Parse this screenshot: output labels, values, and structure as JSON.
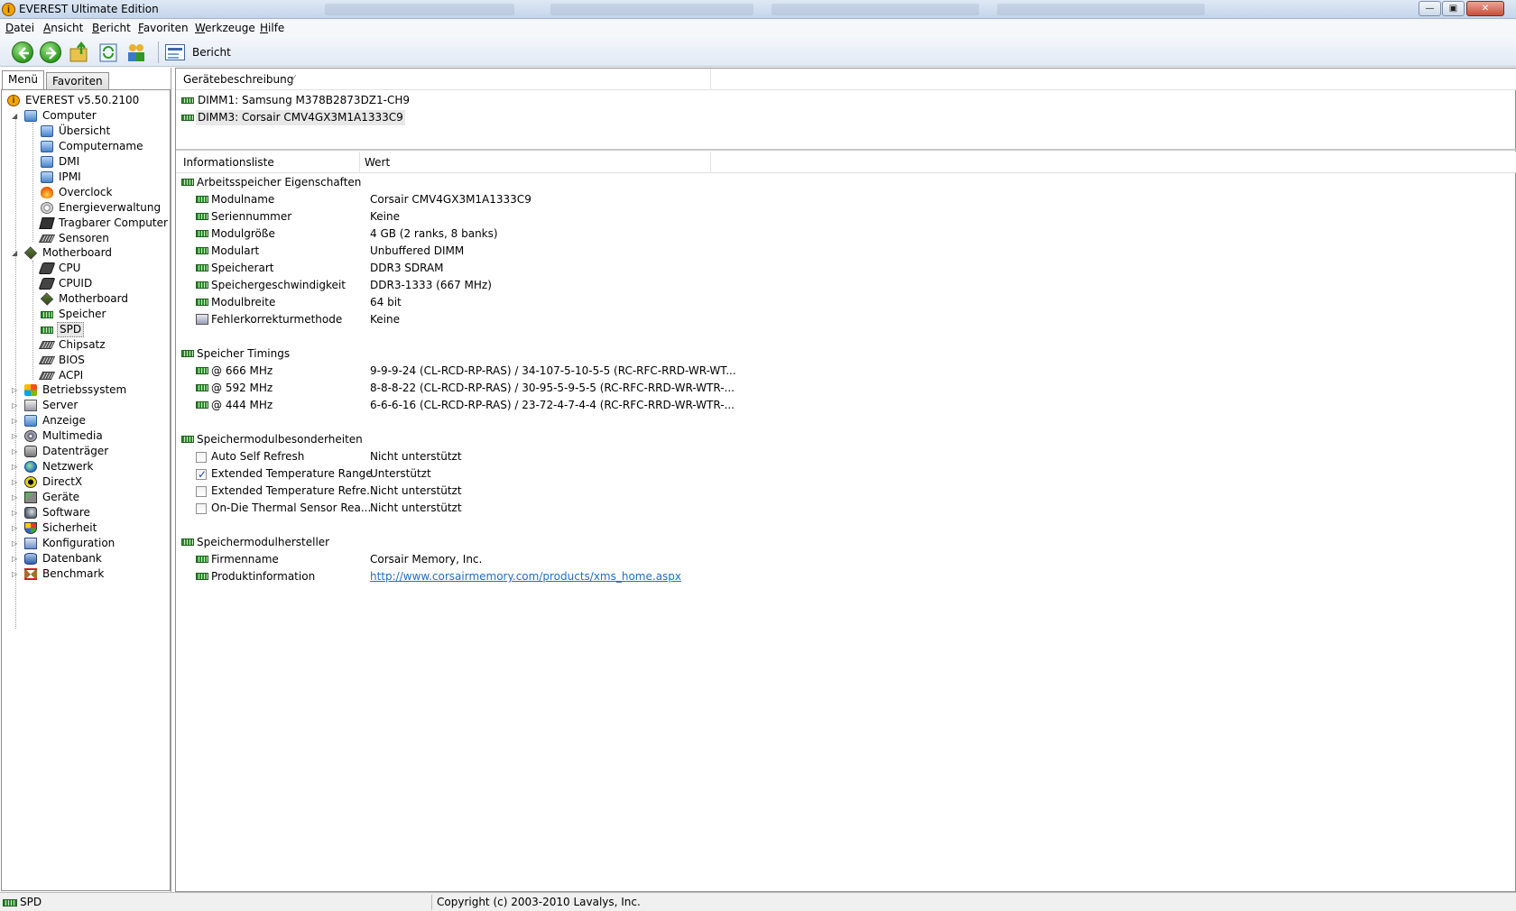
{
  "window": {
    "title": "EVEREST Ultimate Edition"
  },
  "menu": [
    "Datei",
    "Ansicht",
    "Bericht",
    "Favoriten",
    "Werkzeuge",
    "Hilfe"
  ],
  "toolbar": {
    "report_label": "Bericht"
  },
  "tabs": {
    "menu": "Menü",
    "favorites": "Favoriten"
  },
  "tree": {
    "root": "EVEREST v5.50.2100",
    "computer": "Computer",
    "computer_children": [
      "Übersicht",
      "Computername",
      "DMI",
      "IPMI",
      "Overclock",
      "Energieverwaltung",
      "Tragbarer Computer",
      "Sensoren"
    ],
    "motherboard": "Motherboard",
    "motherboard_children": [
      "CPU",
      "CPUID",
      "Motherboard",
      "Speicher",
      "SPD",
      "Chipsatz",
      "BIOS",
      "ACPI"
    ],
    "selected": "SPD",
    "others": [
      "Betriebssystem",
      "Server",
      "Anzeige",
      "Multimedia",
      "Datenträger",
      "Netzwerk",
      "DirectX",
      "Geräte",
      "Software",
      "Sicherheit",
      "Konfiguration",
      "Datenbank",
      "Benchmark"
    ]
  },
  "devices": {
    "header": "Gerätebeschreibung",
    "items": [
      "DIMM1: Samsung M378B2873DZ1-CH9",
      "DIMM3: Corsair CMV4GX3M1A1333C9"
    ],
    "selected_index": 1
  },
  "info": {
    "col_field": "Informationsliste",
    "col_value": "Wert",
    "sections": [
      {
        "title": "Arbeitsspeicher Eigenschaften",
        "rows": [
          {
            "k": "Modulname",
            "v": "Corsair CMV4GX3M1A1333C9"
          },
          {
            "k": "Seriennummer",
            "v": "Keine"
          },
          {
            "k": "Modulgröße",
            "v": "4 GB (2 ranks, 8 banks)"
          },
          {
            "k": "Modulart",
            "v": "Unbuffered DIMM"
          },
          {
            "k": "Speicherart",
            "v": "DDR3 SDRAM"
          },
          {
            "k": "Speichergeschwindigkeit",
            "v": "DDR3-1333 (667 MHz)"
          },
          {
            "k": "Modulbreite",
            "v": "64 bit"
          },
          {
            "k": "Fehlerkorrekturmethode",
            "v": "Keine"
          }
        ]
      },
      {
        "title": "Speicher Timings",
        "rows": [
          {
            "k": "@ 666 MHz",
            "v": "9-9-9-24  (CL-RCD-RP-RAS) / 34-107-5-10-5-5  (RC-RFC-RRD-WR-WT..."
          },
          {
            "k": "@ 592 MHz",
            "v": "8-8-8-22  (CL-RCD-RP-RAS) / 30-95-5-9-5-5  (RC-RFC-RRD-WR-WTR-..."
          },
          {
            "k": "@ 444 MHz",
            "v": "6-6-6-16  (CL-RCD-RP-RAS) / 23-72-4-7-4-4  (RC-RFC-RRD-WR-WTR-..."
          }
        ]
      },
      {
        "title": "Speichermodulbesonderheiten",
        "rows": [
          {
            "k": "Auto Self Refresh",
            "v": "Nicht unterstützt",
            "checked": false
          },
          {
            "k": "Extended Temperature Range",
            "v": "Unterstützt",
            "checked": true
          },
          {
            "k": "Extended Temperature Refre...",
            "v": "Nicht unterstützt",
            "checked": false
          },
          {
            "k": "On-Die Thermal Sensor Rea...",
            "v": "Nicht unterstützt",
            "checked": false
          }
        ]
      },
      {
        "title": "Speichermodulhersteller",
        "rows": [
          {
            "k": "Firmenname",
            "v": "Corsair Memory, Inc."
          },
          {
            "k": "Produktinformation",
            "v": "http://www.corsairmemory.com/products/xms_home.aspx"
          }
        ]
      }
    ]
  },
  "status": {
    "left": "SPD",
    "right": "Copyright (c) 2003-2010 Lavalys, Inc."
  }
}
